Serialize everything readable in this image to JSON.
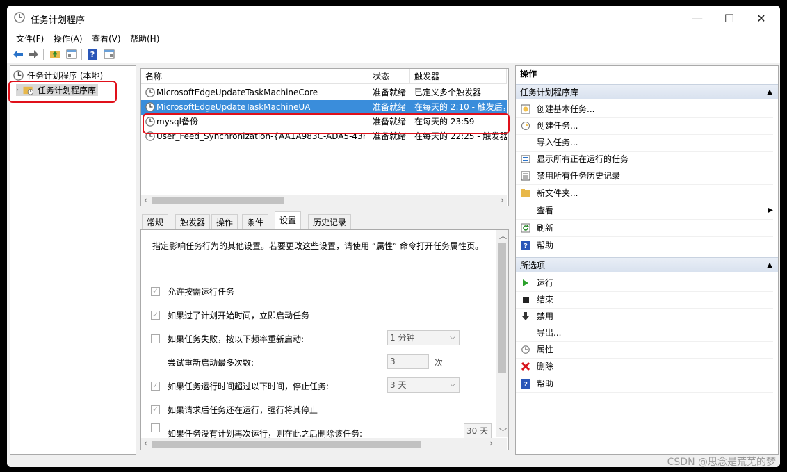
{
  "window": {
    "title": "任务计划程序",
    "controls": [
      "—",
      "☐",
      "✕"
    ]
  },
  "menu": [
    "文件(F)",
    "操作(A)",
    "查看(V)",
    "帮助(H)"
  ],
  "tree": {
    "root": "任务计划程序 (本地)",
    "child": "任务计划程序库"
  },
  "task_table": {
    "columns": [
      "名称",
      "状态",
      "触发器"
    ],
    "rows": [
      {
        "name": "MicrosoftEdgeUpdateTaskMachineCore",
        "status": "准备就绪",
        "trigger": "已定义多个触发器"
      },
      {
        "name": "MicrosoftEdgeUpdateTaskMachineUA",
        "status": "准备就绪",
        "trigger": "在每天的 2:10 - 触发后，"
      },
      {
        "name": "mysql备份",
        "status": "准备就绪",
        "trigger": "在每天的 23:59"
      },
      {
        "name": "User_Feed_Synchronization-{AA1A983C-ADA5-43F...",
        "status": "准备就绪",
        "trigger": "在每天的 22:25 - 触发器"
      }
    ],
    "selected_index": 1
  },
  "tabs": [
    "常规",
    "触发器",
    "操作",
    "条件",
    "设置",
    "历史记录"
  ],
  "active_tab": "设置",
  "settings": {
    "description": "指定影响任务行为的其他设置。若要更改这些设置，请使用 “属性” 命令打开任务属性页。",
    "allow_on_demand": "允许按需运行任务",
    "start_if_missed": "如果过了计划开始时间，立即启动任务",
    "restart_on_fail": "如果任务失败，按以下频率重新启动:",
    "restart_interval": "1 分钟",
    "restart_attempts_label": "尝试重新启动最多次数:",
    "restart_attempts_value": "3",
    "restart_attempts_unit": "次",
    "stop_if_runs_longer": "如果任务运行时间超过以下时间，停止任务:",
    "stop_after": "3 天",
    "force_stop": "如果请求后任务还在运行，强行将其停止",
    "delete_if_not_scheduled": "如果任务没有计划再次运行，则在此之后删除该任务:",
    "delete_after": "30 天"
  },
  "actions_pane": {
    "header": "操作",
    "library_section": "任务计划程序库",
    "library_actions": [
      "创建基本任务...",
      "创建任务...",
      "导入任务...",
      "显示所有正在运行的任务",
      "禁用所有任务历史记录",
      "新文件夹...",
      "查看",
      "刷新",
      "帮助"
    ],
    "selected_section": "所选项",
    "selected_actions": [
      "运行",
      "结束",
      "禁用",
      "导出...",
      "属性",
      "删除",
      "帮助"
    ]
  },
  "watermark": "CSDN @思念是荒芜的梦",
  "colors": {
    "selection": "#3a8ddb",
    "highlight_box": "#e0101a"
  }
}
